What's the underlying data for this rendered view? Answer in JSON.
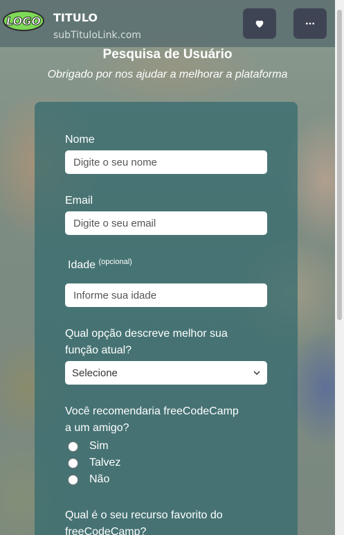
{
  "header": {
    "logo_text": "LOGO",
    "title": "TITULO",
    "subtitle": "subTituloLink.com",
    "favorite_icon": "heart-icon",
    "more_icon": "ellipsis-icon"
  },
  "page": {
    "title": "Pesquisa de Usuário",
    "description": "Obrigado por nos ajudar a melhorar a plataforma"
  },
  "form": {
    "name_label": "Nome",
    "name_placeholder": "Digite o seu nome",
    "email_label": "Email",
    "email_placeholder": "Digite o seu email",
    "age_label": "Idade",
    "age_optional": "(opcional)",
    "age_placeholder": "Informe sua idade",
    "role_question_line1": "Qual opção descreve melhor sua",
    "role_question_line2": "função atual?",
    "role_selected": "Selecione",
    "recommend_question_line1": "Você recomendaria freeCodeCamp",
    "recommend_question_line2": "a um amigo?",
    "recommend_options": [
      "Sim",
      "Talvez",
      "Não"
    ],
    "favorite_question_line1": "Qual é o seu recurso favorito do",
    "favorite_question_line2": "freeCodeCamp?"
  },
  "colors": {
    "header_button_bg": "#3f4454",
    "card_bg": "#32696e"
  }
}
